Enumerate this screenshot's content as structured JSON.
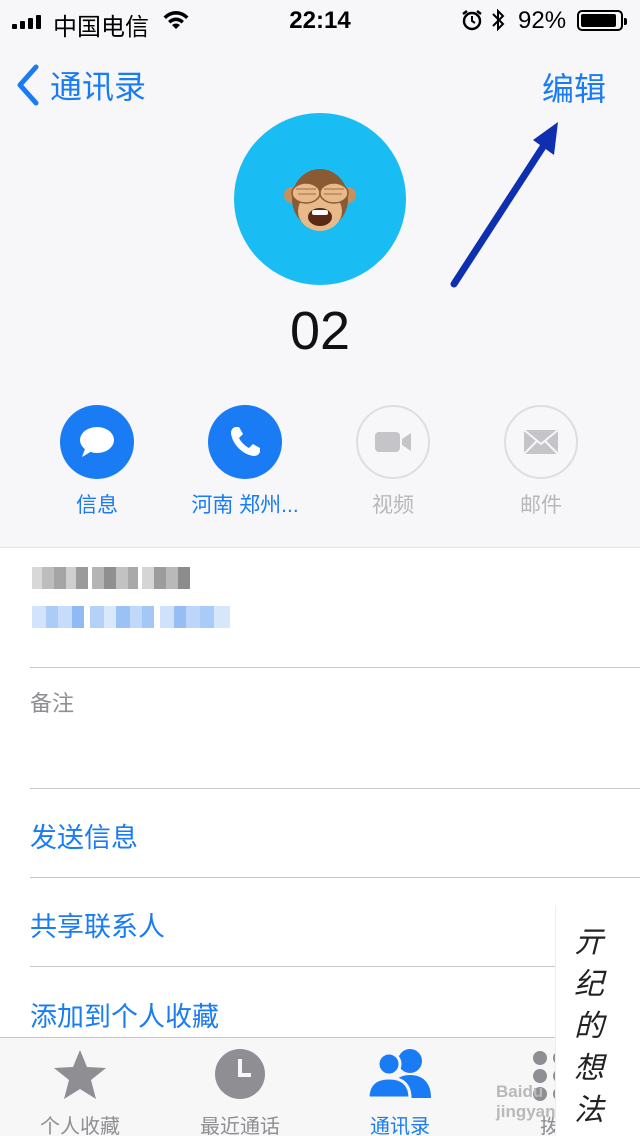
{
  "status": {
    "carrier": "中国电信",
    "time": "22:14",
    "battery_percent": "92%",
    "battery_level": 0.92
  },
  "nav": {
    "back_label": "通讯录",
    "edit_label": "编辑"
  },
  "contact": {
    "name": "02",
    "avatar_emoji": "🙈"
  },
  "actions": [
    {
      "label": "信息",
      "icon": "message-icon",
      "enabled": true
    },
    {
      "label": "河南 郑州...",
      "icon": "phone-icon",
      "enabled": true
    },
    {
      "label": "视频",
      "icon": "video-icon",
      "enabled": false
    },
    {
      "label": "邮件",
      "icon": "mail-icon",
      "enabled": false
    }
  ],
  "notes": {
    "label": "备注"
  },
  "rows": {
    "send_message": "发送信息",
    "share_contact": "共享联系人",
    "add_favorite": "添加到个人收藏"
  },
  "tabs": [
    {
      "label": "个人收藏",
      "icon": "star-icon",
      "active": false
    },
    {
      "label": "最近通话",
      "icon": "clock-icon",
      "active": false
    },
    {
      "label": "通讯录",
      "icon": "contacts-icon",
      "active": true
    },
    {
      "label": "拨号",
      "icon": "keypad-icon",
      "active": false
    }
  ],
  "watermark": {
    "chars": [
      "亓",
      "纪",
      "的",
      "想",
      "法"
    ],
    "brand": "Baidu",
    "brand_sub": "jingyan"
  },
  "colors": {
    "accent": "#1a7cf5",
    "avatar_bg": "#19bdf3",
    "annotation_arrow": "#0d2fb0"
  }
}
